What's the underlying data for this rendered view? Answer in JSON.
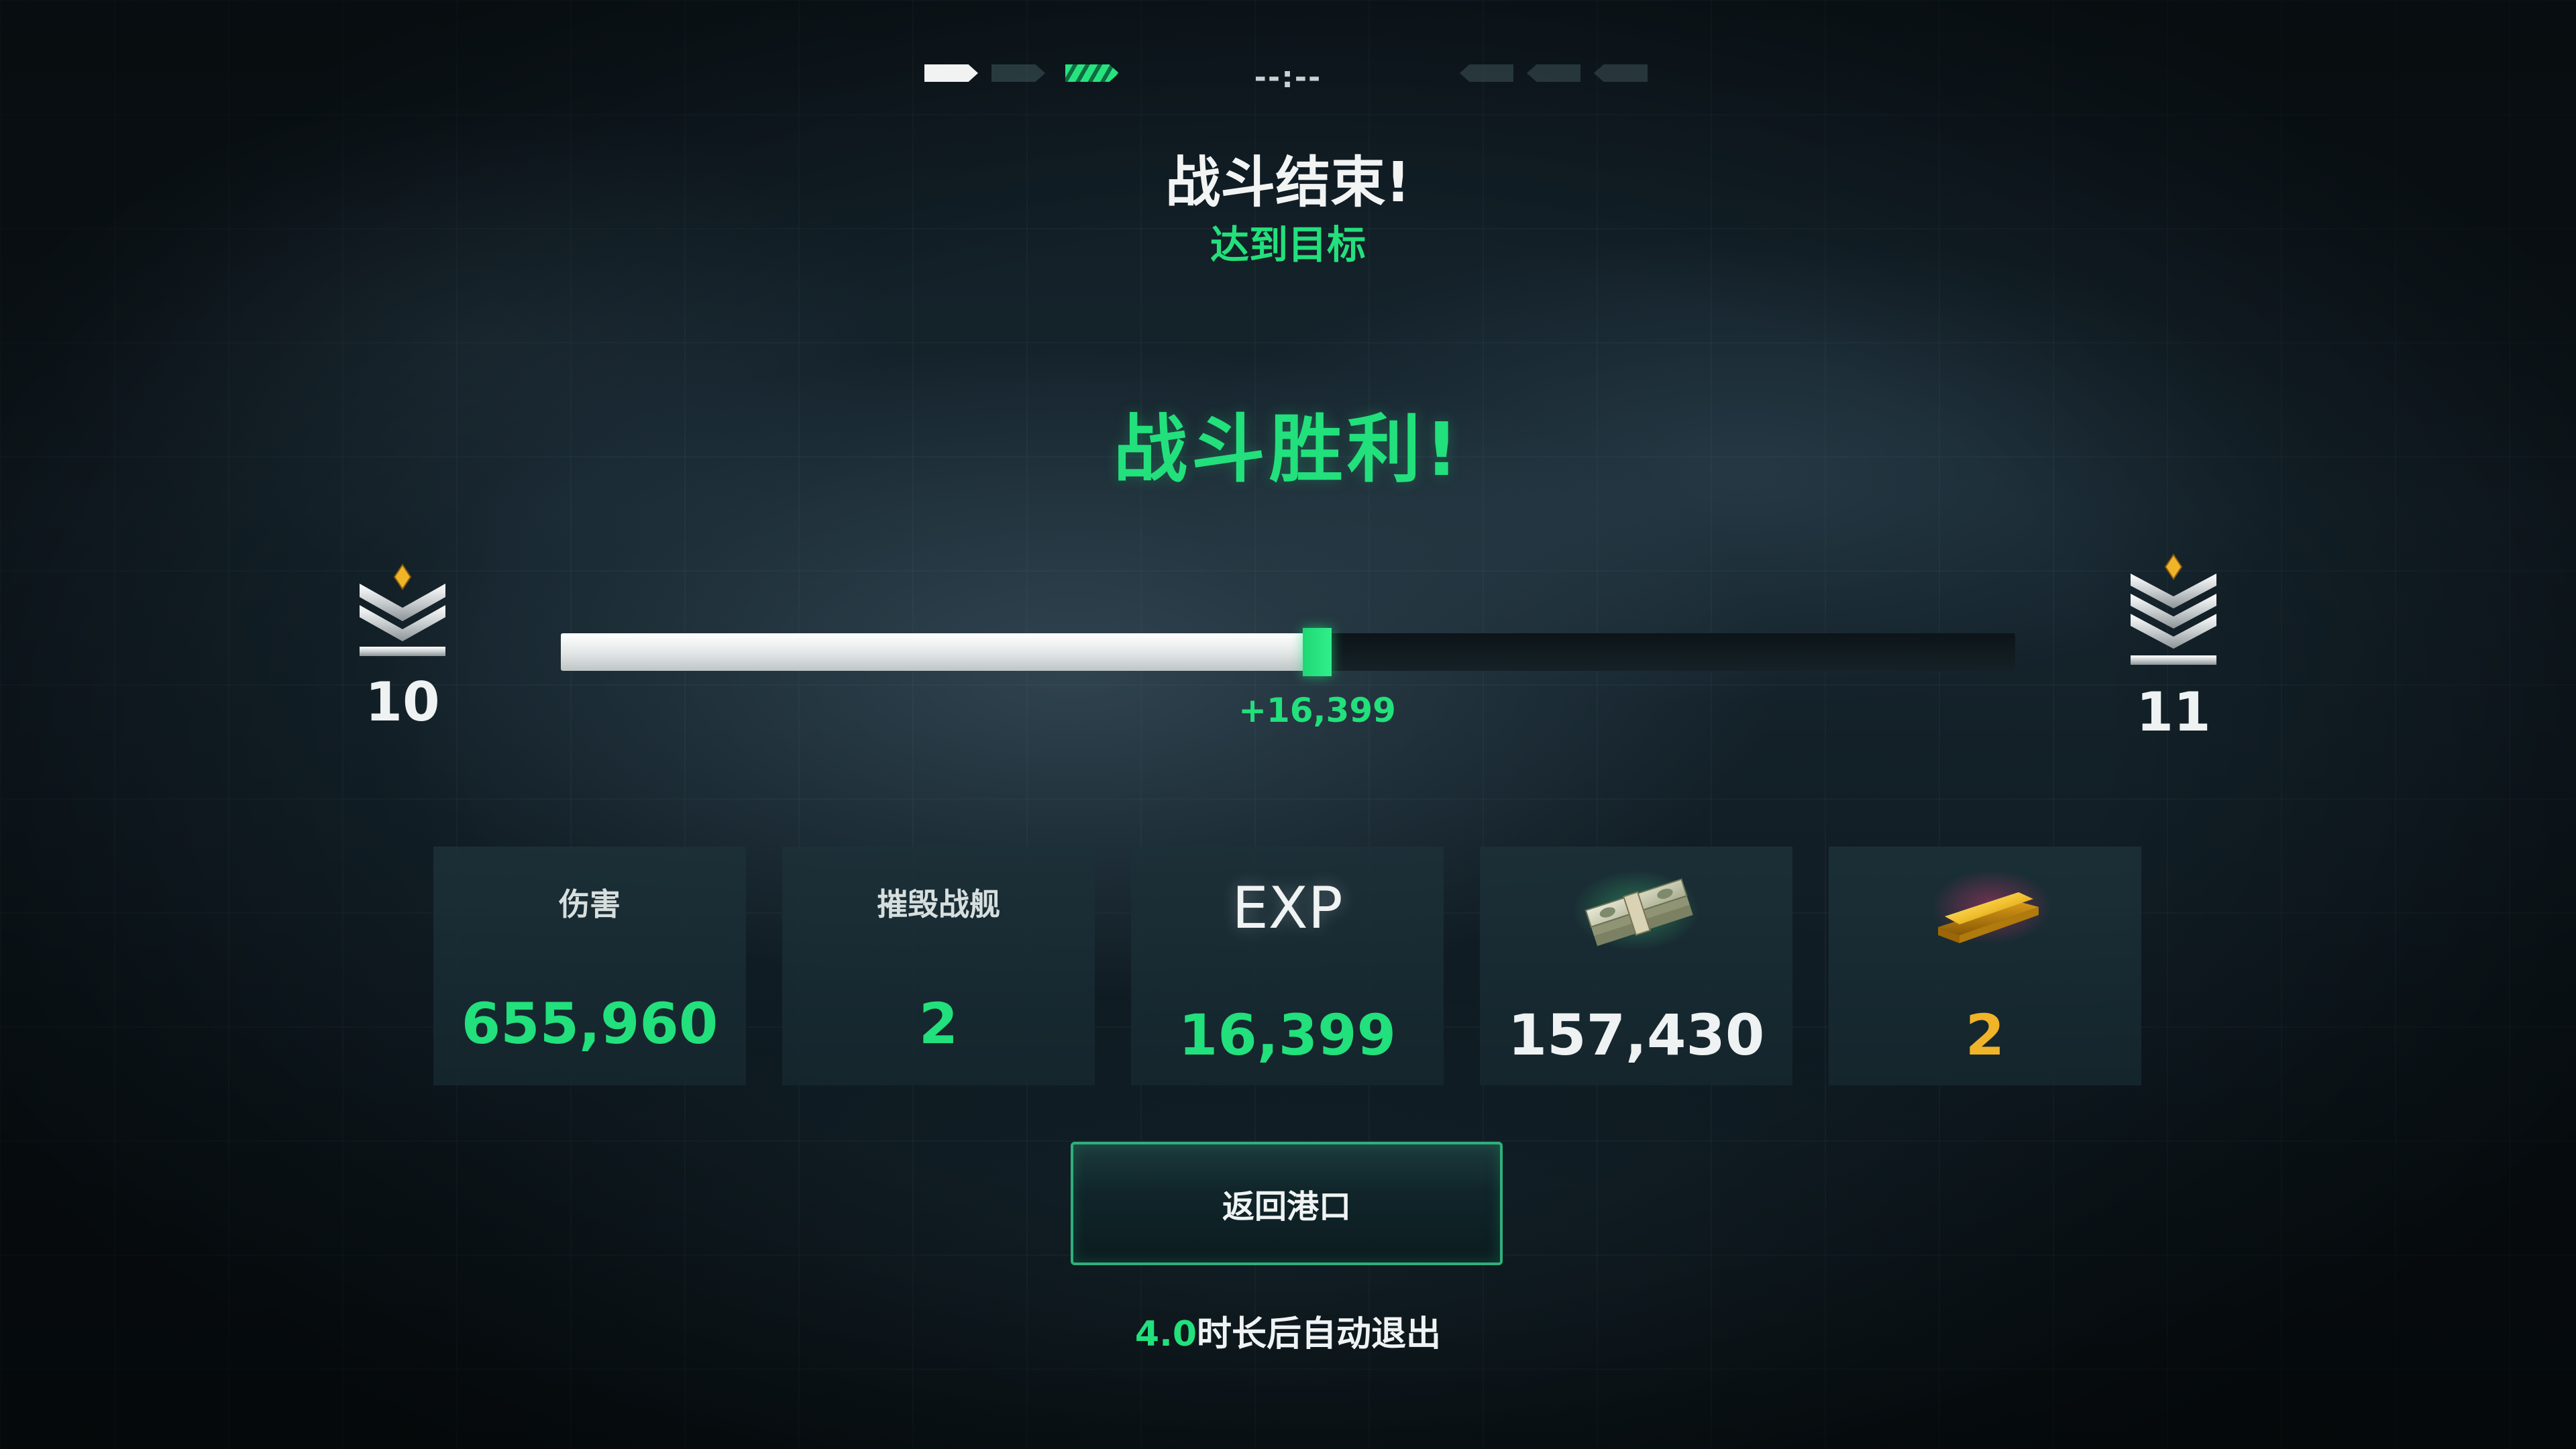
{
  "top_indicator": {
    "timer": "--:--"
  },
  "header": {
    "title": "战斗结束!",
    "subtitle": "达到目标"
  },
  "result": {
    "victory_text": "战斗胜利!"
  },
  "rank": {
    "current_level": "10",
    "next_level": "11",
    "progress_before": 0.51,
    "progress_after": 0.53,
    "gain_label": "+16,399"
  },
  "stats": [
    {
      "label": "伤害",
      "value": "655,960",
      "color": "#22e07c"
    },
    {
      "label": "摧毁战舰",
      "value": "2",
      "color": "#22e07c"
    },
    {
      "label": "EXP",
      "value": "16,399",
      "color": "#22e07c"
    },
    {
      "icon": "cash-stack-icon",
      "value": "157,430",
      "color": "#eef2f2"
    },
    {
      "icon": "gold-bar-icon",
      "value": "2",
      "color": "#f0b429"
    }
  ],
  "actions": {
    "return_label": "返回港口"
  },
  "auto_exit": {
    "seconds": "4.0",
    "text": "时长后自动退出"
  },
  "colors": {
    "accent_green": "#22e07c",
    "gold": "#f0b429"
  }
}
